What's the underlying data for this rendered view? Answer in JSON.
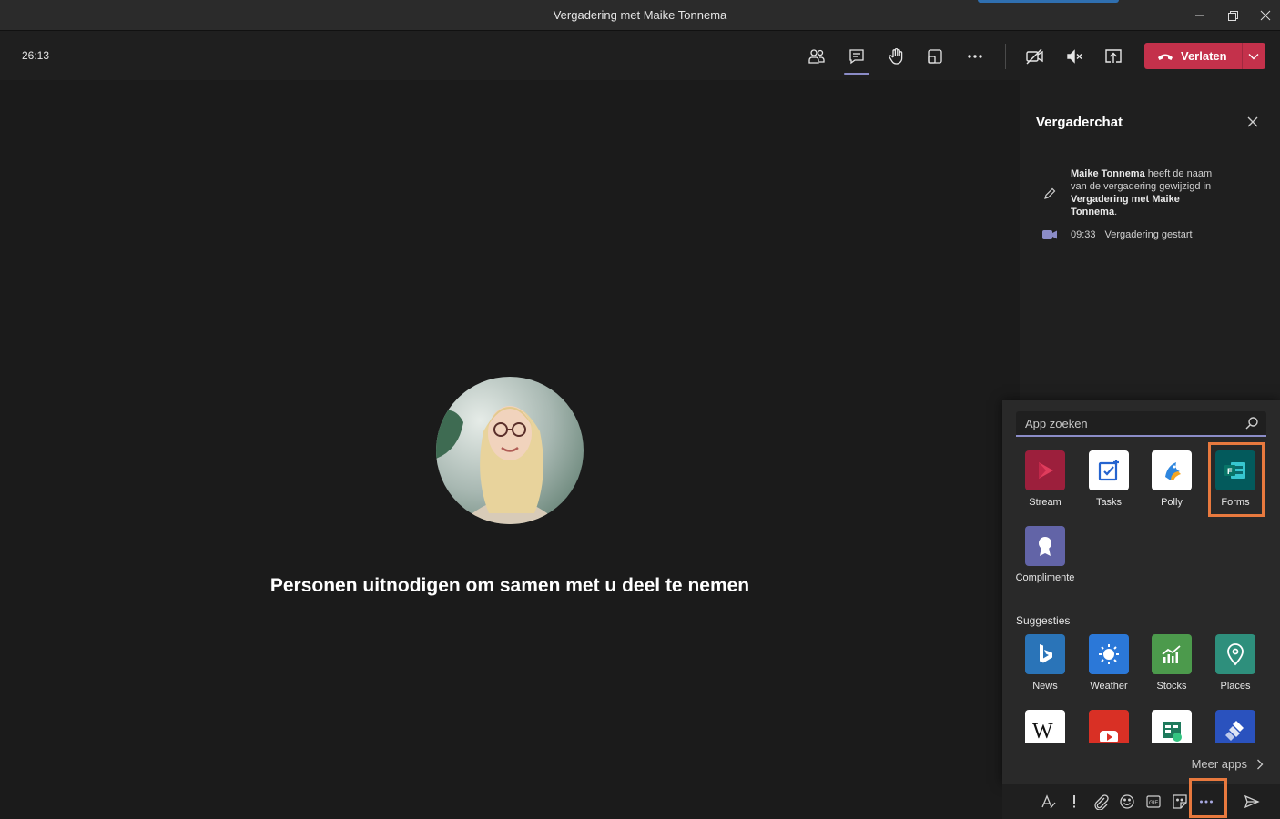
{
  "window": {
    "title": "Vergadering met Maike Tonnema",
    "controls": [
      "minimize-icon",
      "restore-icon",
      "close-icon"
    ]
  },
  "toolbar": {
    "timer": "26:13",
    "buttons": [
      "people-icon",
      "chat-icon",
      "raise-hand-icon",
      "room-view-icon",
      "more-icon",
      "camera-off-icon",
      "speaker-mute-icon",
      "share-icon"
    ],
    "leave_label": "Verlaten"
  },
  "stage": {
    "invite_text": "Personen uitnodigen om samen met u deel te nemen"
  },
  "chat": {
    "title": "Vergaderchat",
    "message1": {
      "actor": "Maike Tonnema",
      "text": "heeft de naam van de vergadering gewijzigd in",
      "new_name": "Vergadering met Maike Tonnema",
      "end": "."
    },
    "message2": {
      "time": "09:33",
      "text": "Vergadering gestart"
    }
  },
  "apps_popup": {
    "search_placeholder": "App zoeken",
    "installed": [
      {
        "label": "Stream",
        "icon": "stream-icon",
        "color": "#9c1f3c"
      },
      {
        "label": "Tasks",
        "icon": "tasks-icon",
        "color": "#ffffff"
      },
      {
        "label": "Polly",
        "icon": "polly-icon",
        "color": "#ffffff"
      },
      {
        "label": "Forms",
        "icon": "forms-icon",
        "color": "#035a5c"
      },
      {
        "label": "Complimente",
        "icon": "praise-icon",
        "color": "#6264a7"
      }
    ],
    "suggestions_label": "Suggesties",
    "suggestions": [
      {
        "label": "News",
        "icon": "bing-news-icon",
        "color": "#2a74b8"
      },
      {
        "label": "Weather",
        "icon": "weather-icon",
        "color": "#2b78d8"
      },
      {
        "label": "Stocks",
        "icon": "stocks-icon",
        "color": "#4c9a4c"
      },
      {
        "label": "Places",
        "icon": "places-icon",
        "color": "#2e8f7c"
      }
    ],
    "more_row": [
      "wikipedia-icon",
      "youtube-icon",
      "approvals-icon",
      "jira-icon"
    ],
    "more_apps_label": "Meer apps"
  },
  "compose": {
    "icons": [
      "format-icon",
      "important-icon",
      "attach-icon",
      "emoji-icon",
      "gif-icon",
      "sticker-icon",
      "more-options-icon",
      "send-icon"
    ]
  },
  "colors": {
    "accent": "#8b8cc7",
    "leave": "#c4314b",
    "highlight": "#e8793e"
  }
}
